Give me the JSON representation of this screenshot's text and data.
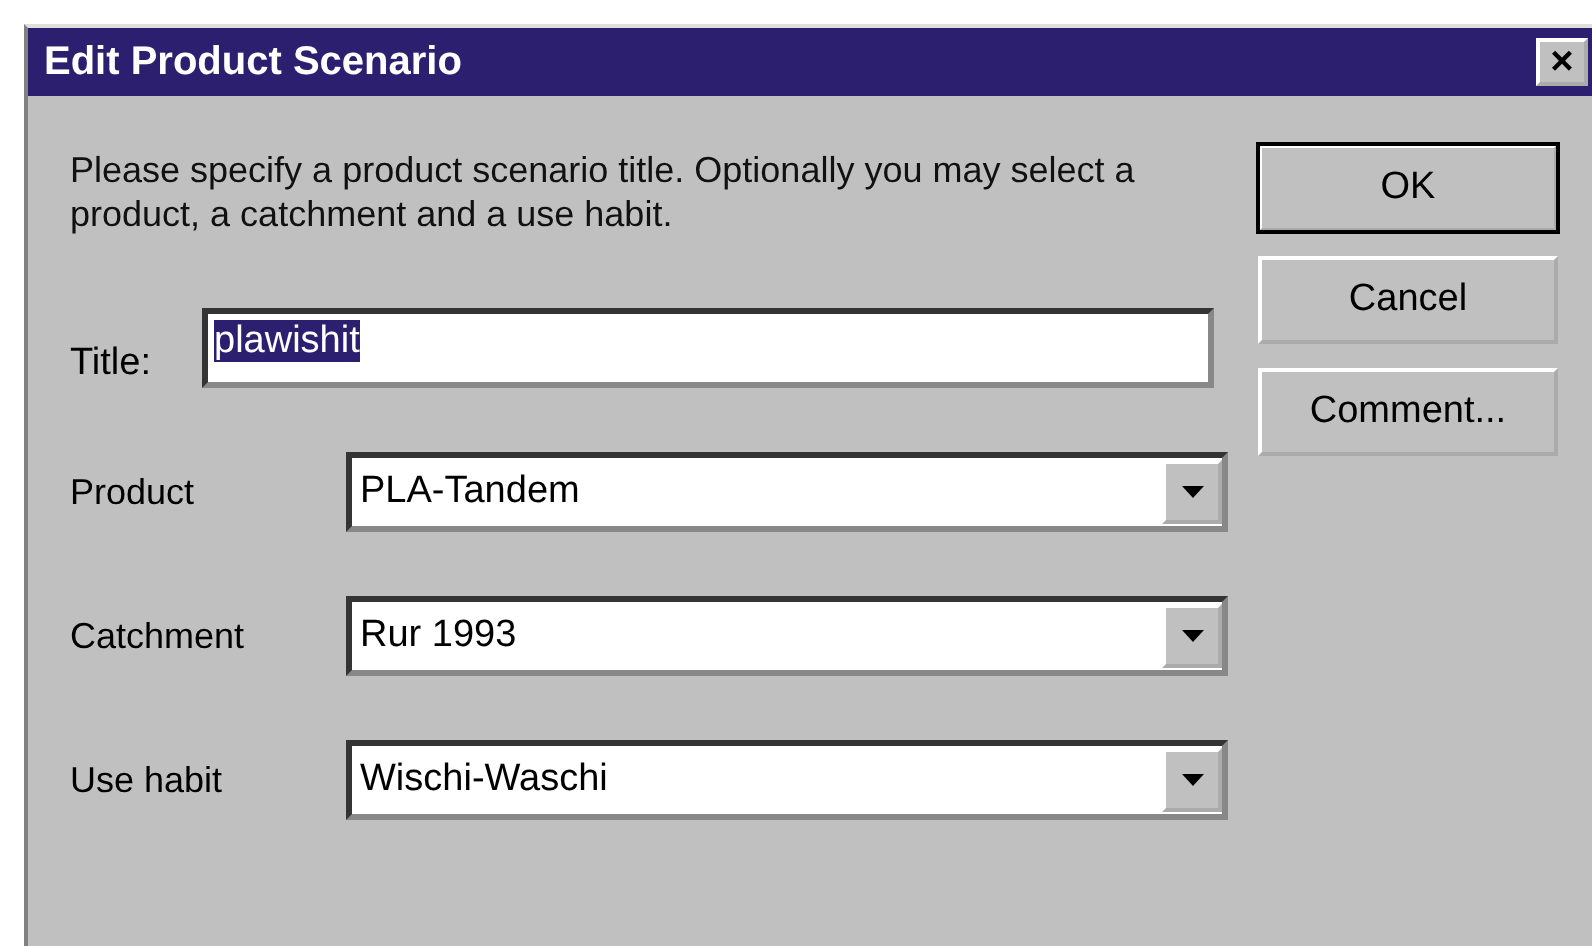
{
  "window": {
    "title": "Edit Product Scenario",
    "close_label": "×"
  },
  "instructions": "Please specify a product scenario title. Optionally you may select a product, a catchment and a use habit.",
  "title_field": {
    "label": "Title:",
    "value": "plawishit",
    "text_selected": true
  },
  "dropdowns": [
    {
      "label": "Product",
      "value": "PLA-Tandem"
    },
    {
      "label": "Catchment",
      "value": "Rur 1993"
    },
    {
      "label": "Use habit",
      "value": "Wischi-Waschi"
    }
  ],
  "buttons": [
    {
      "label": "OK",
      "default": true
    },
    {
      "label": "Cancel",
      "default": false
    },
    {
      "label": "Comment...",
      "default": false
    }
  ]
}
